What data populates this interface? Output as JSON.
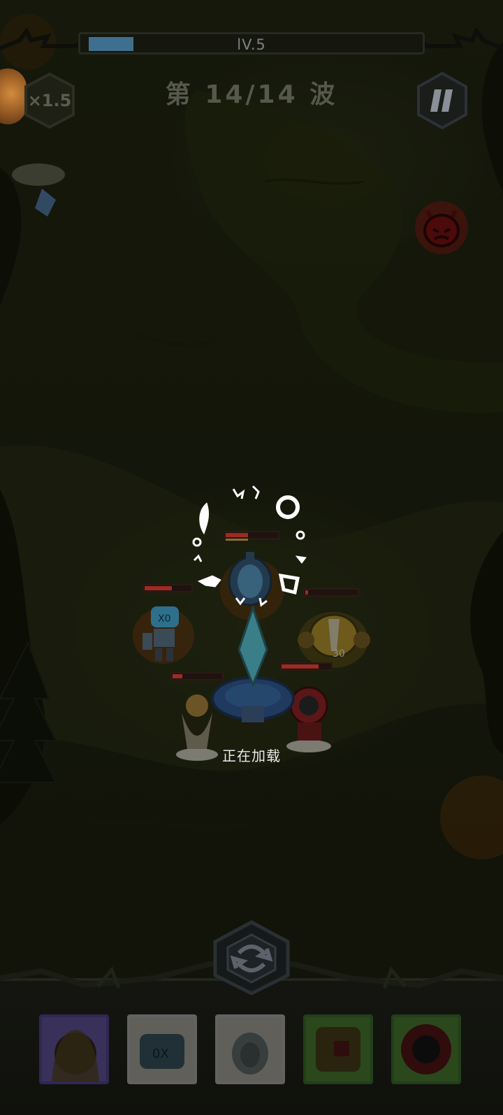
{
  "hud": {
    "level_label": "lV.5",
    "level_progress": 0.14,
    "speed_label": "×1.5",
    "wave_label": "第 14/14 波",
    "pause_icon": "pause-icon",
    "enemy_marker_icon": "devil-head-icon"
  },
  "overlay": {
    "loading_label": "正在加载"
  },
  "battlefield": {
    "damage_text": "30",
    "units": [
      {
        "name": "robot-hero",
        "hp": 0.55
      },
      {
        "name": "alchemist-hero",
        "hp": 0.45
      },
      {
        "name": "golden-mech-hero",
        "hp": 0.05
      },
      {
        "name": "angel-hero",
        "hp": 0.2
      },
      {
        "name": "red-mech-hero",
        "hp": 0.75
      }
    ]
  },
  "hero_bar": {
    "swap_icon": "swap-icon",
    "cards": [
      {
        "name": "angel-hero-card",
        "border": "#6b57b6",
        "bg": "#7f6cc9"
      },
      {
        "name": "robot-hero-card",
        "border": "#d9d9d9",
        "bg": "#d8d4c8"
      },
      {
        "name": "alchemist-hero-card",
        "border": "#d9d9d9",
        "bg": "#d8d4c8"
      },
      {
        "name": "golden-mech-hero-card",
        "border": "#4b8a3b",
        "bg": "#5e9f3f"
      },
      {
        "name": "red-mech-hero-card",
        "border": "#4b8a3b",
        "bg": "#5e9f3f"
      }
    ]
  }
}
